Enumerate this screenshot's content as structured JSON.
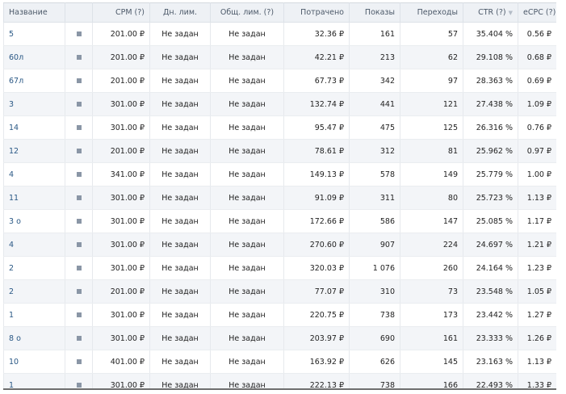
{
  "columns": {
    "name": "Название",
    "status": "",
    "cpm": "CPM (?)",
    "daily_limit": "Дн. лим.",
    "total_limit": "Общ. лим. (?)",
    "spent": "Потрачено",
    "impressions": "Показы",
    "clicks": "Переходы",
    "ctr": "CTR (?)",
    "ecpc": "eCPC (?)"
  },
  "sort": {
    "column": "ctr",
    "direction": "desc",
    "icon": "sort-down-icon"
  },
  "status_icon": "stop-square-icon",
  "rows": [
    {
      "name": "5",
      "cpm": "201.00 ₽",
      "daily_limit": "Не задан",
      "total_limit": "Не задан",
      "spent": "32.36 ₽",
      "impressions": "161",
      "clicks": "57",
      "ctr": "35.404 %",
      "ecpc": "0.56 ₽"
    },
    {
      "name": "60л",
      "cpm": "201.00 ₽",
      "daily_limit": "Не задан",
      "total_limit": "Не задан",
      "spent": "42.21 ₽",
      "impressions": "213",
      "clicks": "62",
      "ctr": "29.108 %",
      "ecpc": "0.68 ₽"
    },
    {
      "name": "67л",
      "cpm": "201.00 ₽",
      "daily_limit": "Не задан",
      "total_limit": "Не задан",
      "spent": "67.73 ₽",
      "impressions": "342",
      "clicks": "97",
      "ctr": "28.363 %",
      "ecpc": "0.69 ₽"
    },
    {
      "name": "3",
      "cpm": "301.00 ₽",
      "daily_limit": "Не задан",
      "total_limit": "Не задан",
      "spent": "132.74 ₽",
      "impressions": "441",
      "clicks": "121",
      "ctr": "27.438 %",
      "ecpc": "1.09 ₽"
    },
    {
      "name": "14",
      "cpm": "301.00 ₽",
      "daily_limit": "Не задан",
      "total_limit": "Не задан",
      "spent": "95.47 ₽",
      "impressions": "475",
      "clicks": "125",
      "ctr": "26.316 %",
      "ecpc": "0.76 ₽"
    },
    {
      "name": "12",
      "cpm": "201.00 ₽",
      "daily_limit": "Не задан",
      "total_limit": "Не задан",
      "spent": "78.61 ₽",
      "impressions": "312",
      "clicks": "81",
      "ctr": "25.962 %",
      "ecpc": "0.97 ₽"
    },
    {
      "name": "4",
      "cpm": "341.00 ₽",
      "daily_limit": "Не задан",
      "total_limit": "Не задан",
      "spent": "149.13 ₽",
      "impressions": "578",
      "clicks": "149",
      "ctr": "25.779 %",
      "ecpc": "1.00 ₽"
    },
    {
      "name": "11",
      "cpm": "301.00 ₽",
      "daily_limit": "Не задан",
      "total_limit": "Не задан",
      "spent": "91.09 ₽",
      "impressions": "311",
      "clicks": "80",
      "ctr": "25.723 %",
      "ecpc": "1.13 ₽"
    },
    {
      "name": "3 о",
      "cpm": "301.00 ₽",
      "daily_limit": "Не задан",
      "total_limit": "Не задан",
      "spent": "172.66 ₽",
      "impressions": "586",
      "clicks": "147",
      "ctr": "25.085 %",
      "ecpc": "1.17 ₽"
    },
    {
      "name": "4",
      "cpm": "301.00 ₽",
      "daily_limit": "Не задан",
      "total_limit": "Не задан",
      "spent": "270.60 ₽",
      "impressions": "907",
      "clicks": "224",
      "ctr": "24.697 %",
      "ecpc": "1.21 ₽"
    },
    {
      "name": "2",
      "cpm": "301.00 ₽",
      "daily_limit": "Не задан",
      "total_limit": "Не задан",
      "spent": "320.03 ₽",
      "impressions": "1 076",
      "clicks": "260",
      "ctr": "24.164 %",
      "ecpc": "1.23 ₽"
    },
    {
      "name": "2",
      "cpm": "201.00 ₽",
      "daily_limit": "Не задан",
      "total_limit": "Не задан",
      "spent": "77.07 ₽",
      "impressions": "310",
      "clicks": "73",
      "ctr": "23.548 %",
      "ecpc": "1.05 ₽"
    },
    {
      "name": "1",
      "cpm": "301.00 ₽",
      "daily_limit": "Не задан",
      "total_limit": "Не задан",
      "spent": "220.75 ₽",
      "impressions": "738",
      "clicks": "173",
      "ctr": "23.442 %",
      "ecpc": "1.27 ₽"
    },
    {
      "name": "8 о",
      "cpm": "301.00 ₽",
      "daily_limit": "Не задан",
      "total_limit": "Не задан",
      "spent": "203.97 ₽",
      "impressions": "690",
      "clicks": "161",
      "ctr": "23.333 %",
      "ecpc": "1.26 ₽"
    },
    {
      "name": "10",
      "cpm": "401.00 ₽",
      "daily_limit": "Не задан",
      "total_limit": "Не задан",
      "spent": "163.92 ₽",
      "impressions": "626",
      "clicks": "145",
      "ctr": "23.163 %",
      "ecpc": "1.13 ₽"
    },
    {
      "name": "1",
      "cpm": "301.00 ₽",
      "daily_limit": "Не задан",
      "total_limit": "Не задан",
      "spent": "222.13 ₽",
      "impressions": "738",
      "clicks": "166",
      "ctr": "22.493 %",
      "ecpc": "1.33 ₽"
    }
  ]
}
